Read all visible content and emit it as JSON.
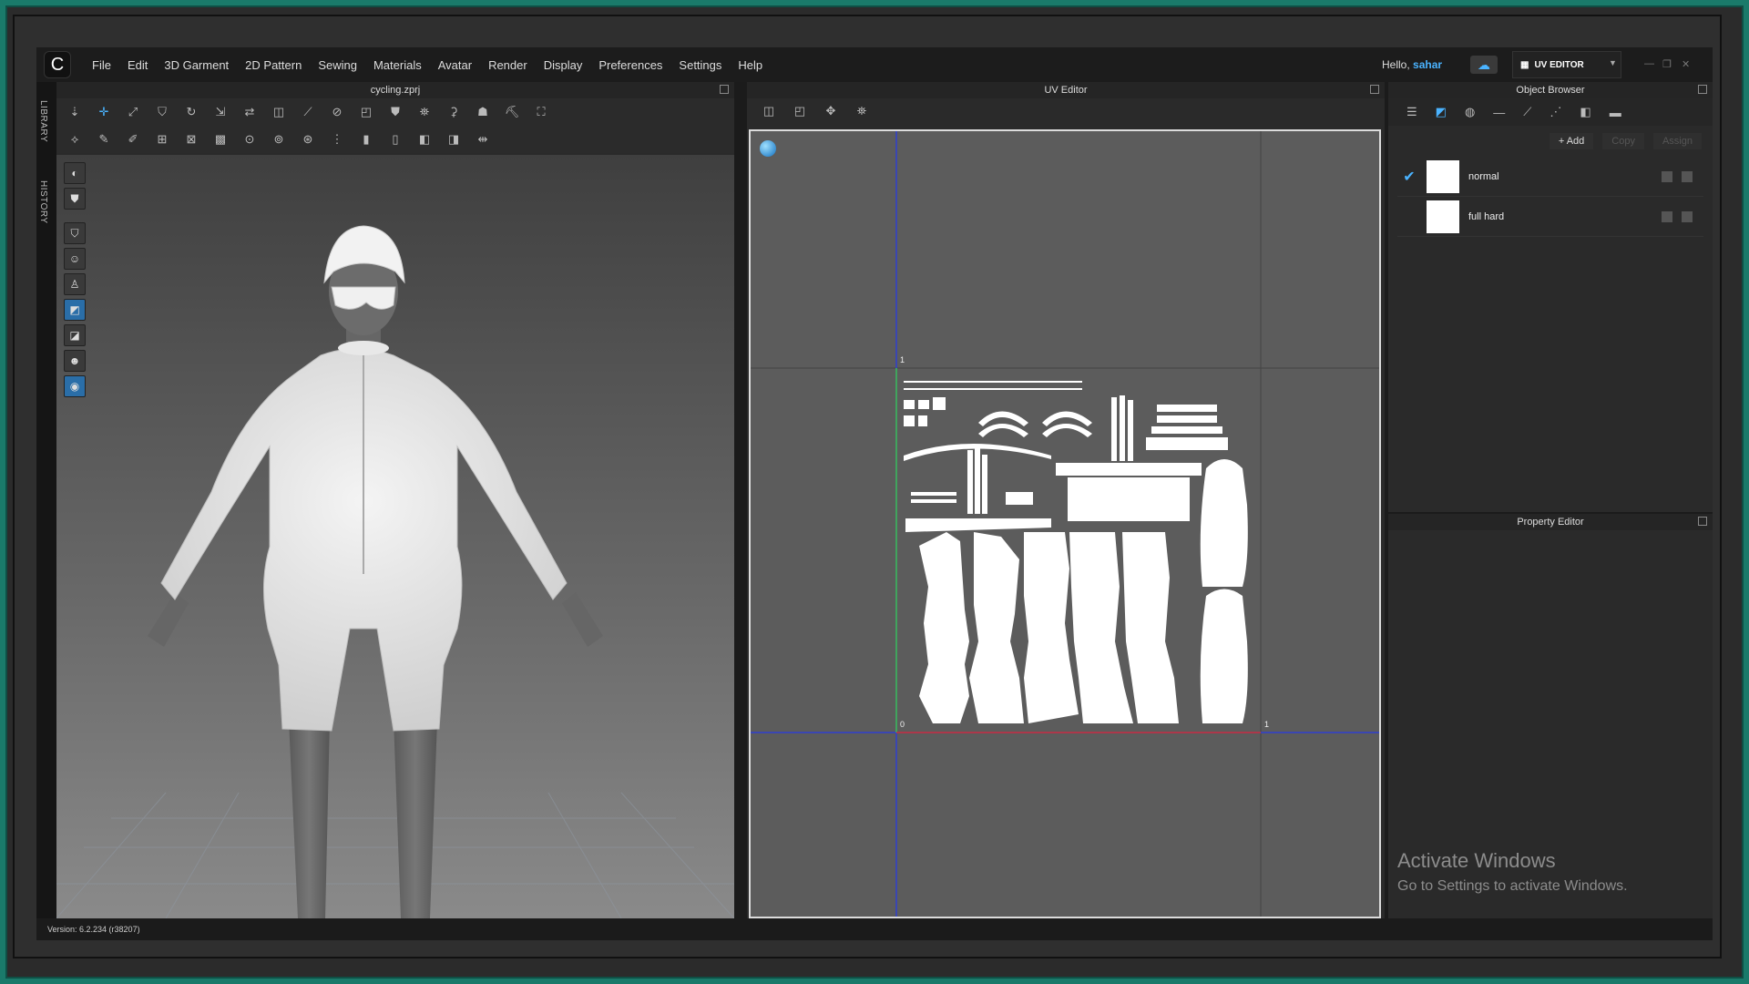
{
  "menubar": {
    "logo": "C",
    "items": [
      "File",
      "Edit",
      "3D Garment",
      "2D Pattern",
      "Sewing",
      "Materials",
      "Avatar",
      "Render",
      "Display",
      "Preferences",
      "Settings",
      "Help"
    ],
    "greeting": "Hello,",
    "username": "sahar",
    "mode_label": "UV EDITOR"
  },
  "side_tabs": {
    "library": "LIBRARY",
    "history": "HISTORY"
  },
  "panel3d": {
    "title": "cycling.zprj"
  },
  "uv_editor": {
    "title": "UV Editor",
    "tick_one_top": "1",
    "tick_zero": "0",
    "tick_one_right": "1"
  },
  "object_browser": {
    "title": "Object Browser",
    "add_label": "Add",
    "copy_label": "Copy",
    "assign_label": "Assign",
    "materials": [
      {
        "name": "normal",
        "selected": true
      },
      {
        "name": "full hard",
        "selected": false
      }
    ]
  },
  "property_editor": {
    "title": "Property Editor"
  },
  "watermark": {
    "line1": "Activate Windows",
    "line2": "Go to Settings to activate Windows."
  },
  "status": {
    "version": "Version: 6.2.234 (r38207)"
  },
  "colors": {
    "accent": "#4ab3ff",
    "teal_frame": "#1a7a6a",
    "panel_bg": "#2a2a2a",
    "uv_bg": "#5c5c5c"
  }
}
